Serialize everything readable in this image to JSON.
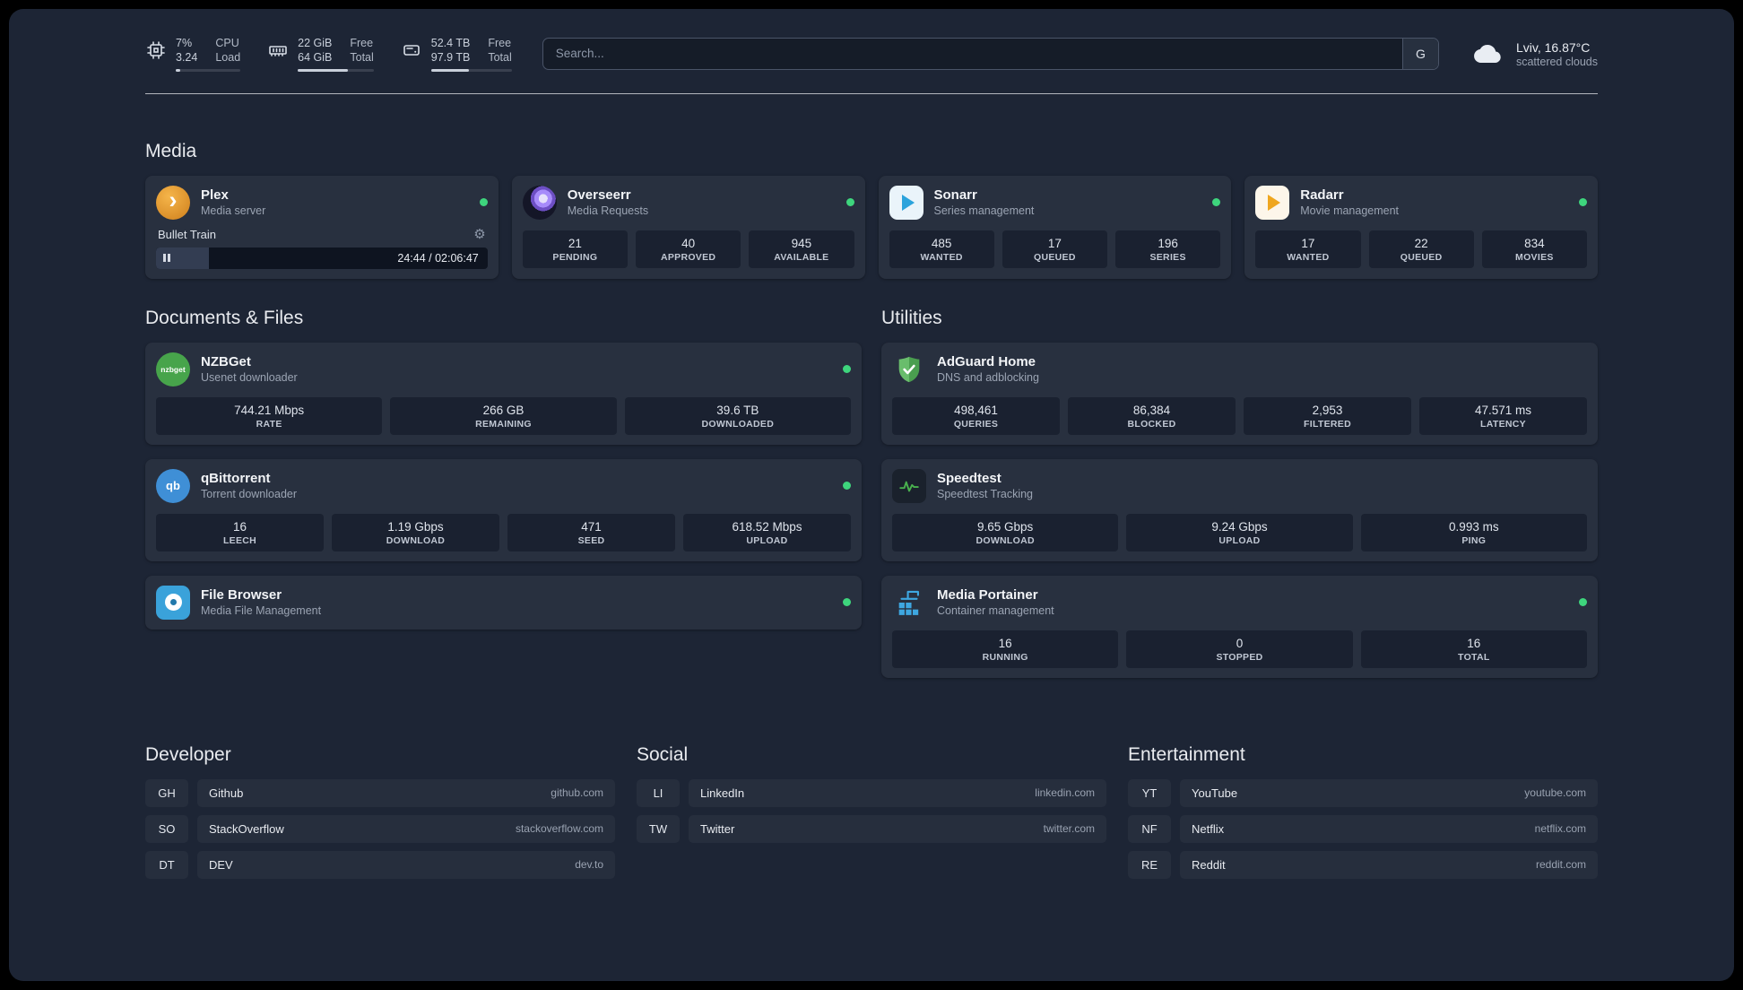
{
  "header": {
    "stats": [
      {
        "icon": "cpu-icon",
        "value_top": "7%",
        "value_bottom": "3.24",
        "label_top": "CPU",
        "label_bottom": "Load",
        "bar_percent": 7
      },
      {
        "icon": "memory-icon",
        "value_top": "22 GiB",
        "value_bottom": "64 GiB",
        "label_top": "Free",
        "label_bottom": "Total",
        "bar_percent": 66
      },
      {
        "icon": "disk-icon",
        "value_top": "52.4 TB",
        "value_bottom": "97.9 TB",
        "label_top": "Free",
        "label_bottom": "Total",
        "bar_percent": 47
      }
    ],
    "search": {
      "placeholder": "Search...",
      "provider": "G"
    },
    "weather": {
      "icon": "cloud-icon",
      "location": "Lviv, 16.87°C",
      "condition": "scattered clouds"
    }
  },
  "sections": {
    "media": {
      "title": "Media",
      "services": [
        {
          "icon": "plex-icon",
          "name": "Plex",
          "subtitle": "Media server",
          "status": "online",
          "player": {
            "track": "Bullet Train",
            "time": "24:44 / 02:06:47",
            "progress_percent": 16
          }
        },
        {
          "icon": "overseerr-icon",
          "name": "Overseerr",
          "subtitle": "Media Requests",
          "status": "online",
          "stats": [
            {
              "value": "21",
              "label": "PENDING"
            },
            {
              "value": "40",
              "label": "APPROVED"
            },
            {
              "value": "945",
              "label": "AVAILABLE"
            }
          ]
        },
        {
          "icon": "sonarr-icon",
          "name": "Sonarr",
          "subtitle": "Series management",
          "status": "online",
          "stats": [
            {
              "value": "485",
              "label": "WANTED"
            },
            {
              "value": "17",
              "label": "QUEUED"
            },
            {
              "value": "196",
              "label": "SERIES"
            }
          ]
        },
        {
          "icon": "radarr-icon",
          "name": "Radarr",
          "subtitle": "Movie management",
          "status": "online",
          "stats": [
            {
              "value": "17",
              "label": "WANTED"
            },
            {
              "value": "22",
              "label": "QUEUED"
            },
            {
              "value": "834",
              "label": "MOVIES"
            }
          ]
        }
      ]
    },
    "documents": {
      "title": "Documents & Files",
      "services": [
        {
          "icon": "nzbget-icon",
          "icon_text": "nzbget",
          "name": "NZBGet",
          "subtitle": "Usenet downloader",
          "status": "online",
          "stats": [
            {
              "value": "744.21 Mbps",
              "label": "RATE"
            },
            {
              "value": "266 GB",
              "label": "REMAINING"
            },
            {
              "value": "39.6 TB",
              "label": "DOWNLOADED"
            }
          ]
        },
        {
          "icon": "qbittorrent-icon",
          "icon_text": "qb",
          "name": "qBittorrent",
          "subtitle": "Torrent downloader",
          "status": "online",
          "stats": [
            {
              "value": "16",
              "label": "LEECH"
            },
            {
              "value": "1.19 Gbps",
              "label": "DOWNLOAD"
            },
            {
              "value": "471",
              "label": "SEED"
            },
            {
              "value": "618.52 Mbps",
              "label": "UPLOAD"
            }
          ]
        },
        {
          "icon": "filebrowser-icon",
          "name": "File Browser",
          "subtitle": "Media File Management",
          "status": "online",
          "stats": []
        }
      ]
    },
    "utilities": {
      "title": "Utilities",
      "services": [
        {
          "icon": "adguard-icon",
          "name": "AdGuard Home",
          "subtitle": "DNS and adblocking",
          "status": null,
          "stats": [
            {
              "value": "498,461",
              "label": "QUERIES"
            },
            {
              "value": "86,384",
              "label": "BLOCKED"
            },
            {
              "value": "2,953",
              "label": "FILTERED"
            },
            {
              "value": "47.571 ms",
              "label": "LATENCY"
            }
          ]
        },
        {
          "icon": "speedtest-icon",
          "name": "Speedtest",
          "subtitle": "Speedtest Tracking",
          "status": null,
          "stats": [
            {
              "value": "9.65 Gbps",
              "label": "DOWNLOAD"
            },
            {
              "value": "9.24 Gbps",
              "label": "UPLOAD"
            },
            {
              "value": "0.993 ms",
              "label": "PING"
            }
          ]
        },
        {
          "icon": "portainer-icon",
          "name": "Media Portainer",
          "subtitle": "Container management",
          "status": "online",
          "stats": [
            {
              "value": "16",
              "label": "RUNNING"
            },
            {
              "value": "0",
              "label": "STOPPED"
            },
            {
              "value": "16",
              "label": "TOTAL"
            }
          ]
        }
      ]
    }
  },
  "bookmarks": [
    {
      "title": "Developer",
      "items": [
        {
          "abbr": "GH",
          "name": "Github",
          "url": "github.com"
        },
        {
          "abbr": "SO",
          "name": "StackOverflow",
          "url": "stackoverflow.com"
        },
        {
          "abbr": "DT",
          "name": "DEV",
          "url": "dev.to"
        }
      ]
    },
    {
      "title": "Social",
      "items": [
        {
          "abbr": "LI",
          "name": "LinkedIn",
          "url": "linkedin.com"
        },
        {
          "abbr": "TW",
          "name": "Twitter",
          "url": "twitter.com"
        }
      ]
    },
    {
      "title": "Entertainment",
      "items": [
        {
          "abbr": "YT",
          "name": "YouTube",
          "url": "youtube.com"
        },
        {
          "abbr": "NF",
          "name": "Netflix",
          "url": "netflix.com"
        },
        {
          "abbr": "RE",
          "name": "Reddit",
          "url": "reddit.com"
        }
      ]
    }
  ],
  "colors": {
    "status_online": "#3ed57d",
    "panel_bg": "#1d2535",
    "card_bg": "#28303f",
    "tile_bg": "#1a2130"
  }
}
